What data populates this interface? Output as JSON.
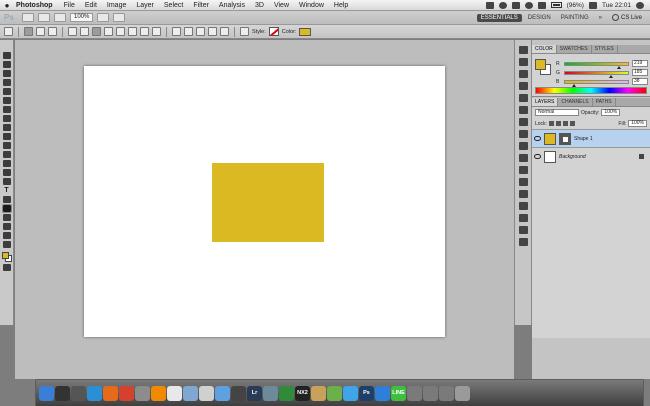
{
  "menubar": {
    "app_name": "Photoshop",
    "menus": [
      "File",
      "Edit",
      "Image",
      "Layer",
      "Select",
      "Filter",
      "Analysis",
      "3D",
      "View",
      "Window",
      "Help"
    ],
    "battery": "(96%)",
    "clock": "Tue 22:01"
  },
  "appbar": {
    "logo": "Ps",
    "zoom": "100%",
    "workspaces": [
      "ESSENTIALS",
      "DESIGN",
      "PAINTING",
      "»"
    ],
    "cs_live": "CS Live"
  },
  "options": {
    "style_label": "Style:",
    "color_label": "Color:"
  },
  "colors": {
    "accent": "#dbb923",
    "selection": "#b7d2ee"
  },
  "color_panel": {
    "tabs": [
      "COLOR",
      "SWATCHES",
      "STYLES"
    ],
    "channels": [
      {
        "label": "R",
        "value": "219",
        "fraction": 0.86
      },
      {
        "label": "G",
        "value": "185",
        "fraction": 0.73
      },
      {
        "label": "B",
        "value": "38",
        "fraction": 0.15
      }
    ]
  },
  "layers_panel": {
    "tabs": [
      "LAYERS",
      "CHANNELS",
      "PATHS"
    ],
    "blend_mode": "Normal",
    "opacity_label": "Opacity:",
    "opacity": "100%",
    "lock_label": "Lock:",
    "fill_label": "Fill:",
    "fill": "100%",
    "layers": [
      {
        "name": "Shape 1",
        "selected": true
      },
      {
        "name": "Background",
        "selected": false
      }
    ]
  },
  "dock": {
    "apps": [
      {
        "name": "finder-icon",
        "label": "",
        "color": "#3b7ed6"
      },
      {
        "name": "dashboard-icon",
        "label": "",
        "color": "#333333"
      },
      {
        "name": "mission-control-icon",
        "label": "",
        "color": "#555555"
      },
      {
        "name": "app-store-icon",
        "label": "",
        "color": "#2b8fd6"
      },
      {
        "name": "firefox-icon",
        "label": "",
        "color": "#e66a1b"
      },
      {
        "name": "chrome-icon",
        "label": "",
        "color": "#d6402f"
      },
      {
        "name": "system-prefs-icon",
        "label": "",
        "color": "#8c8c8c"
      },
      {
        "name": "vlc-icon",
        "label": "",
        "color": "#f08a00"
      },
      {
        "name": "calendar-icon",
        "label": "",
        "color": "#e8e8e8"
      },
      {
        "name": "mail-icon",
        "label": "",
        "color": "#7fa7cf"
      },
      {
        "name": "ical-icon",
        "label": "",
        "color": "#d0d0d0"
      },
      {
        "name": "itunes-icon",
        "label": "",
        "color": "#5fa0e0"
      },
      {
        "name": "aperture-icon",
        "label": "",
        "color": "#444444"
      },
      {
        "name": "lightroom-icon",
        "label": "Lr",
        "color": "#2a3c55"
      },
      {
        "name": "utility-icon",
        "label": "",
        "color": "#6c8a9a"
      },
      {
        "name": "leaf-icon",
        "label": "",
        "color": "#2f8a3a"
      },
      {
        "name": "nx2-icon",
        "label": "NX2",
        "color": "#222222"
      },
      {
        "name": "box-icon",
        "label": "",
        "color": "#c8a15a"
      },
      {
        "name": "greenbox-icon",
        "label": "",
        "color": "#6bb04a"
      },
      {
        "name": "twitter-icon",
        "label": "",
        "color": "#3fa4e8"
      },
      {
        "name": "photoshop-icon",
        "label": "Ps",
        "color": "#1f3f6b"
      },
      {
        "name": "web-icon",
        "label": "",
        "color": "#2d7fd8"
      },
      {
        "name": "line-icon",
        "label": "LINE",
        "color": "#3fbf3f"
      },
      {
        "name": "applications-folder-icon",
        "label": "",
        "color": "#7a7a7a"
      },
      {
        "name": "documents-folder-icon",
        "label": "",
        "color": "#7a7a7a"
      },
      {
        "name": "downloads-folder-icon",
        "label": "",
        "color": "#7a7a7a"
      },
      {
        "name": "trash-icon",
        "label": "",
        "color": "#9a9a9a"
      }
    ]
  }
}
